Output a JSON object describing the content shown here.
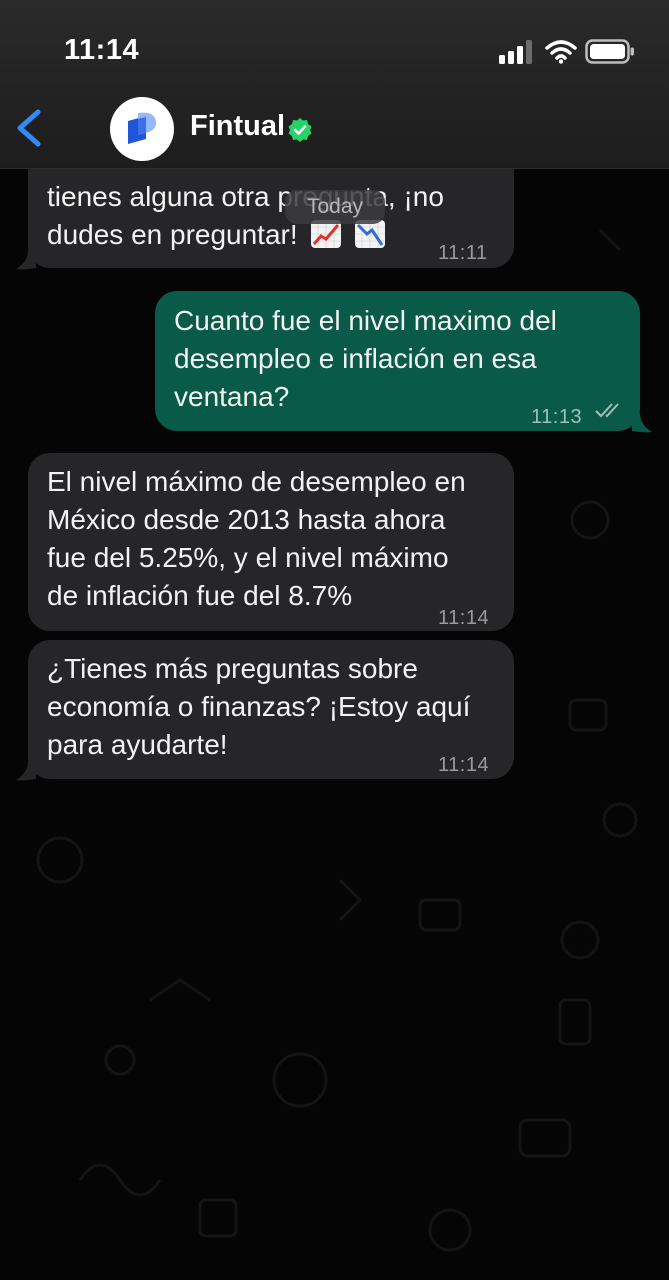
{
  "status_bar": {
    "time": "11:14"
  },
  "header": {
    "contact_name": "Fintual",
    "verified": true,
    "accent_color": "#1e7cf2",
    "verified_color": "#25d366"
  },
  "date_separator": "Today",
  "messages": [
    {
      "direction": "in",
      "text": "tienes alguna otra pregunta, ¡no",
      "text_line2": "dudes en preguntar!",
      "emojis": [
        "chart-increasing-icon",
        "chart-decreasing-icon"
      ],
      "time": "11:11"
    },
    {
      "direction": "out",
      "lines": [
        "Cuanto fue el nivel maximo del",
        "desempleo e inflación en esa",
        "ventana?"
      ],
      "time": "11:13",
      "status": "read"
    },
    {
      "direction": "in",
      "lines": [
        "El nivel máximo de desempleo en",
        "México desde 2013 hasta ahora",
        "fue del 5.25%, y el nivel máximo",
        "de inflación fue del 8.7%"
      ],
      "time": "11:14"
    },
    {
      "direction": "in",
      "lines": [
        "¿Tienes más preguntas sobre",
        "economía o finanzas? ¡Estoy aquí",
        "para ayudarte!"
      ],
      "time": "11:14"
    }
  ],
  "colors": {
    "incoming_bubble": "#262628",
    "outgoing_bubble": "#0a5a4a",
    "background": "#050505"
  }
}
